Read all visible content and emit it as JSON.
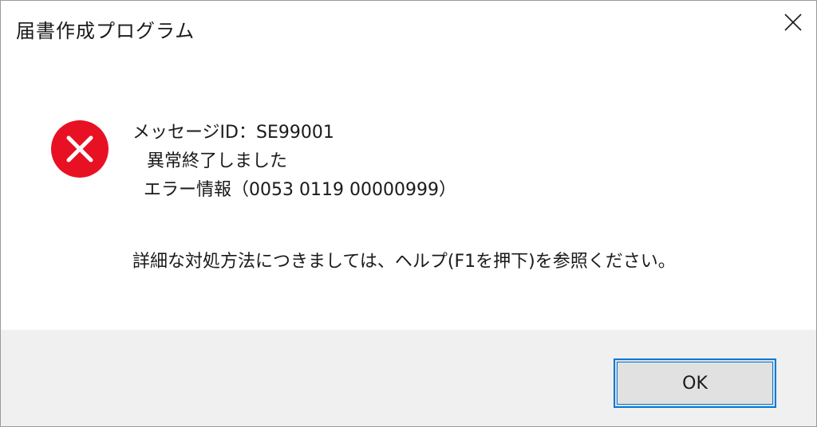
{
  "window": {
    "title": "届書作成プログラム",
    "close_icon": "close-icon"
  },
  "message": {
    "icon": "error-icon",
    "icon_color": "#e81123",
    "line1": "メッセージID：SE99001",
    "line2": "異常終了しました",
    "line3": "エラー情報（0053 0119 00000999）",
    "detail": "詳細な対処方法につきましては、ヘルプ(F1を押下)を参照ください。"
  },
  "footer": {
    "ok_label": "OK",
    "accent": "#0078d7"
  }
}
